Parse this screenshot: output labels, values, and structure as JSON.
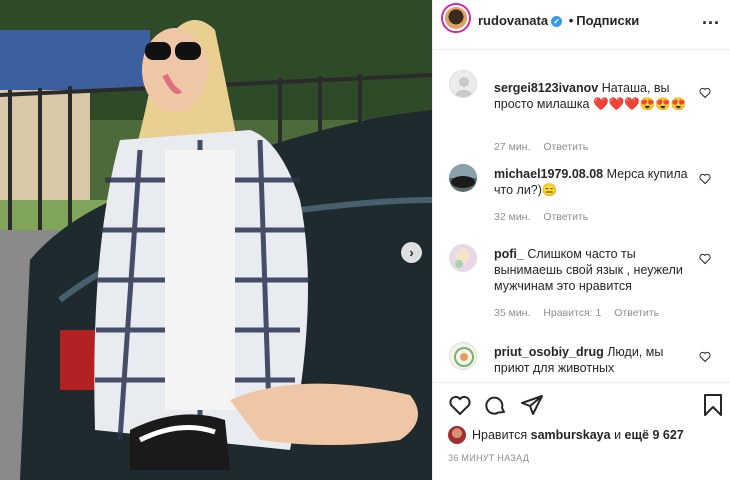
{
  "header": {
    "username": "rudovanata",
    "separator": "•",
    "follow_label": "Подписки",
    "more_label": "..."
  },
  "photo": {
    "next_label": "›"
  },
  "comments": [
    {
      "username": "sergei8123ivanov",
      "text": "Наташа, вы просто милашка ❤️❤️❤️😍😍😍",
      "time": "27 мин.",
      "reply": "Ответить",
      "likes": ""
    },
    {
      "username": "michael1979.08.08",
      "text": "Мерса купила что ли?)😑",
      "time": "32 мин.",
      "reply": "Ответить",
      "likes": ""
    },
    {
      "username": "pofi_",
      "text": "Слишком часто ты вынимаешь свой язык , неужели мужчинам это нравится",
      "time": "35 мин.",
      "reply": "Ответить",
      "likes": "Нравится: 1"
    },
    {
      "username": "priut_osobiy_drug",
      "text": "Люди, мы приют для животных",
      "time": "",
      "reply": "",
      "likes": ""
    }
  ],
  "likes": {
    "prefix": "Нравится",
    "user": "samburskaya",
    "and": "и",
    "others": "ещё 9 627"
  },
  "timestamp": "36 МИНУТ НАЗАД",
  "colors": {
    "verified": "#3897f0",
    "muted": "#8e8e8e",
    "text": "#262626"
  }
}
